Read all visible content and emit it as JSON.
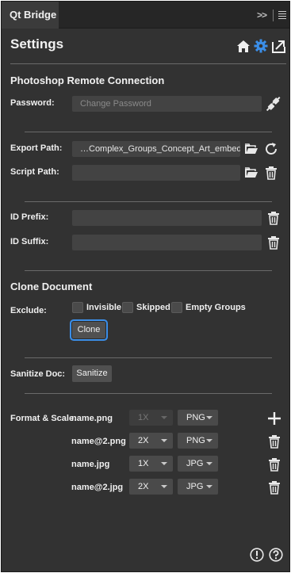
{
  "tab": {
    "title": "Qt Bridge"
  },
  "tabbar": {
    "collapse_glyph": ">>"
  },
  "header": {
    "title": "Settings"
  },
  "remote": {
    "heading": "Photoshop Remote Connection",
    "password_label": "Password:",
    "password_placeholder": "Change Password"
  },
  "paths": {
    "export_label": "Export Path:",
    "export_value": "…Complex_Groups_Concept_Art_embedded/",
    "script_label": "Script Path:",
    "script_value": ""
  },
  "ids": {
    "prefix_label": "ID Prefix:",
    "prefix_value": "",
    "suffix_label": "ID Suffix:",
    "suffix_value": ""
  },
  "clone": {
    "heading": "Clone Document",
    "exclude_label": "Exclude:",
    "options": [
      "Invisible",
      "Skipped",
      "Empty Groups"
    ],
    "button": "Clone"
  },
  "sanitize": {
    "label": "Sanitize Doc:",
    "button": "Sanitize"
  },
  "format": {
    "label": "Format & Scale:",
    "rows": [
      {
        "name": "name.png",
        "scale": "1X",
        "format": "PNG",
        "scale_disabled": true
      },
      {
        "name": "name@2.png",
        "scale": "2X",
        "format": "PNG",
        "scale_disabled": false
      },
      {
        "name": "name.jpg",
        "scale": "1X",
        "format": "JPG",
        "scale_disabled": false
      },
      {
        "name": "name@2.jpg",
        "scale": "2X",
        "format": "JPG",
        "scale_disabled": false
      }
    ]
  },
  "colors": {
    "accent": "#3b8ee8",
    "panel": "#323232",
    "field": "#434343"
  },
  "icons": [
    "home-icon",
    "gear-icon",
    "export-icon",
    "plug-icon",
    "folder-icon",
    "refresh-icon",
    "trash-icon",
    "plus-icon",
    "warning-icon",
    "help-icon",
    "menu-icon"
  ]
}
